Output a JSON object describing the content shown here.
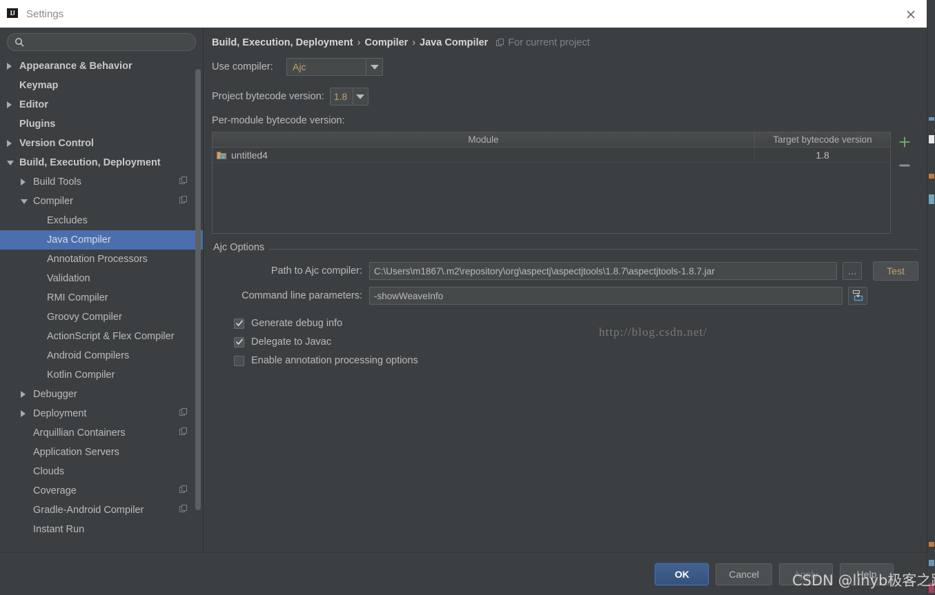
{
  "window": {
    "title": "Settings",
    "logo_text": "IJ",
    "close_icon": "close-icon"
  },
  "sidebar": {
    "search": {
      "value": "",
      "placeholder": "",
      "icon": "search-icon"
    },
    "items": [
      {
        "label": "Appearance & Behavior",
        "level": 0,
        "arrow": "right",
        "bold": true,
        "copy": false,
        "selected": false
      },
      {
        "label": "Keymap",
        "level": 0,
        "arrow": "none",
        "bold": true,
        "copy": false,
        "selected": false
      },
      {
        "label": "Editor",
        "level": 0,
        "arrow": "right",
        "bold": true,
        "copy": false,
        "selected": false
      },
      {
        "label": "Plugins",
        "level": 0,
        "arrow": "none",
        "bold": true,
        "copy": false,
        "selected": false
      },
      {
        "label": "Version Control",
        "level": 0,
        "arrow": "right",
        "bold": true,
        "copy": false,
        "selected": false
      },
      {
        "label": "Build, Execution, Deployment",
        "level": 0,
        "arrow": "down",
        "bold": true,
        "copy": false,
        "selected": false
      },
      {
        "label": "Build Tools",
        "level": 1,
        "arrow": "right",
        "bold": false,
        "copy": true,
        "selected": false
      },
      {
        "label": "Compiler",
        "level": 1,
        "arrow": "down",
        "bold": false,
        "copy": true,
        "selected": false
      },
      {
        "label": "Excludes",
        "level": 2,
        "arrow": "none",
        "bold": false,
        "copy": false,
        "selected": false
      },
      {
        "label": "Java Compiler",
        "level": 2,
        "arrow": "none",
        "bold": false,
        "copy": false,
        "selected": true
      },
      {
        "label": "Annotation Processors",
        "level": 2,
        "arrow": "none",
        "bold": false,
        "copy": false,
        "selected": false
      },
      {
        "label": "Validation",
        "level": 2,
        "arrow": "none",
        "bold": false,
        "copy": false,
        "selected": false
      },
      {
        "label": "RMI Compiler",
        "level": 2,
        "arrow": "none",
        "bold": false,
        "copy": false,
        "selected": false
      },
      {
        "label": "Groovy Compiler",
        "level": 2,
        "arrow": "none",
        "bold": false,
        "copy": false,
        "selected": false
      },
      {
        "label": "ActionScript & Flex Compiler",
        "level": 2,
        "arrow": "none",
        "bold": false,
        "copy": false,
        "selected": false
      },
      {
        "label": "Android Compilers",
        "level": 2,
        "arrow": "none",
        "bold": false,
        "copy": false,
        "selected": false
      },
      {
        "label": "Kotlin Compiler",
        "level": 2,
        "arrow": "none",
        "bold": false,
        "copy": false,
        "selected": false
      },
      {
        "label": "Debugger",
        "level": 1,
        "arrow": "right",
        "bold": false,
        "copy": false,
        "selected": false
      },
      {
        "label": "Deployment",
        "level": 1,
        "arrow": "right",
        "bold": false,
        "copy": true,
        "selected": false
      },
      {
        "label": "Arquillian Containers",
        "level": 1,
        "arrow": "none",
        "bold": false,
        "copy": true,
        "selected": false
      },
      {
        "label": "Application Servers",
        "level": 1,
        "arrow": "none",
        "bold": false,
        "copy": false,
        "selected": false
      },
      {
        "label": "Clouds",
        "level": 1,
        "arrow": "none",
        "bold": false,
        "copy": false,
        "selected": false
      },
      {
        "label": "Coverage",
        "level": 1,
        "arrow": "none",
        "bold": false,
        "copy": true,
        "selected": false
      },
      {
        "label": "Gradle-Android Compiler",
        "level": 1,
        "arrow": "none",
        "bold": false,
        "copy": true,
        "selected": false
      },
      {
        "label": "Instant Run",
        "level": 1,
        "arrow": "none",
        "bold": false,
        "copy": false,
        "selected": false
      }
    ]
  },
  "main": {
    "breadcrumb": {
      "parts": [
        "Build, Execution, Deployment",
        "Compiler",
        "Java Compiler"
      ],
      "separator": "›",
      "scope_label": "For current project",
      "scope_icon": "copy-icon"
    },
    "use_compiler": {
      "label": "Use compiler:",
      "value": "Ajc"
    },
    "project_bytecode": {
      "label": "Project bytecode version:",
      "value": "1.8"
    },
    "per_module_label": "Per-module bytecode version:",
    "module_table": {
      "columns": [
        "Module",
        "Target bytecode version"
      ],
      "rows": [
        {
          "module": "untitled4",
          "target": "1.8",
          "icon": "module-folder-icon"
        }
      ],
      "add_button": "+",
      "remove_button": "–"
    },
    "ajc_options": {
      "title": "Ajc Options",
      "path_label": "Path to Ajc compiler:",
      "path_value": "C:\\Users\\m1867\\.m2\\repository\\org\\aspectj\\aspectjtools\\1.8.7\\aspectjtools-1.8.7.jar",
      "browse_button": "…",
      "test_button": "Test",
      "params_label": "Command line parameters:",
      "params_value": "-showWeaveInfo",
      "expand_button_icon": "expand-editor-icon",
      "checkboxes": [
        {
          "label": "Generate debug info",
          "checked": true
        },
        {
          "label": "Delegate to Javac",
          "checked": true
        },
        {
          "label": "Enable annotation processing options",
          "checked": false
        }
      ]
    }
  },
  "footer": {
    "buttons": [
      {
        "label": "OK",
        "style": "primary"
      },
      {
        "label": "Cancel",
        "style": "normal"
      },
      {
        "label": "Apply",
        "style": "disabled"
      },
      {
        "label": "Help",
        "style": "normal"
      }
    ]
  },
  "watermarks": {
    "url": "http://blog.csdn.net/",
    "author": "CSDN @linyb极客之路"
  },
  "colors": {
    "dialog_bg": "#3c3f41",
    "selection_blue": "#4b6eaf",
    "accent_gold": "#c3a16b",
    "add_green": "#6aab5f",
    "title_bar": "#ffffff"
  }
}
